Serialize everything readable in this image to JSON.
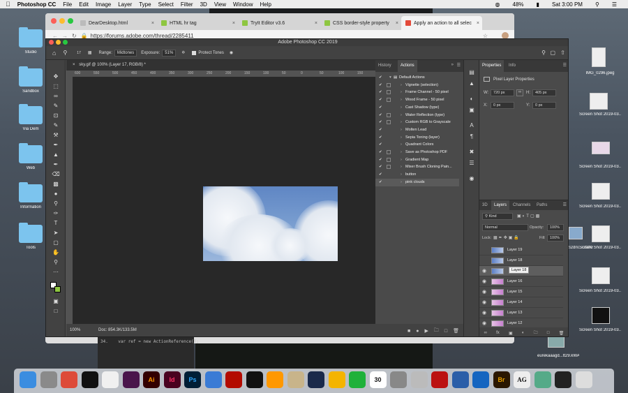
{
  "menubar": {
    "app_name": "Photoshop CC",
    "items": [
      "File",
      "Edit",
      "Image",
      "Layer",
      "Type",
      "Select",
      "Filter",
      "3D",
      "View",
      "Window",
      "Help"
    ],
    "battery": "48%",
    "clock": "Sat 3:00 PM"
  },
  "browser": {
    "tabs": [
      {
        "label": "DearDesktop.html",
        "color": "#bbbbbb"
      },
      {
        "label": "HTML hr tag",
        "color": "#8ec641"
      },
      {
        "label": "TryIt Editor v3.6",
        "color": "#8ec641"
      },
      {
        "label": "CSS border-style property",
        "color": "#8ec641"
      },
      {
        "label": "Apply an action to all selec",
        "color": "#e34a3a"
      }
    ],
    "url": "https://forums.adobe.com/thread/2285411"
  },
  "photoshop": {
    "window_title": "Adobe Photoshop CC 2019",
    "options": {
      "brush_size": "17",
      "range_label": "Range:",
      "range_value": "Midtones",
      "exposure_label": "Exposure:",
      "exposure_value": "51%",
      "protect_tones": "Protect Tones"
    },
    "document_tab": "sky.gif @ 100% (Layer 17, RGB/8) *",
    "ruler_ticks": [
      "600",
      "550",
      "500",
      "450",
      "400",
      "350",
      "300",
      "250",
      "200",
      "150",
      "100",
      "50",
      "0",
      "50",
      "100",
      "150",
      "200",
      "250",
      "300",
      "350",
      "400",
      "450",
      "500",
      "550",
      "600",
      "650",
      "700",
      "750",
      "800",
      "850",
      "900"
    ],
    "status": {
      "zoom": "100%",
      "doc_size": "Doc: 854.3K/133.5M"
    },
    "actions_panel": {
      "tabs": [
        "History",
        "Actions"
      ],
      "items": [
        {
          "label": "Default Actions",
          "folder": true
        },
        {
          "label": "Vignette (selection)"
        },
        {
          "label": "Frame Channel - 50 pixel"
        },
        {
          "label": "Wood Frame - 50 pixel"
        },
        {
          "label": "Cast Shadow (type)"
        },
        {
          "label": "Water Reflection (type)"
        },
        {
          "label": "Custom RGB to Grayscale"
        },
        {
          "label": "Molten Lead"
        },
        {
          "label": "Sepia Toning (layer)"
        },
        {
          "label": "Quadrant Colors"
        },
        {
          "label": "Save as Photoshop PDF"
        },
        {
          "label": "Gradient Map"
        },
        {
          "label": "Mixer Brush Cloning Pain..."
        },
        {
          "label": "button"
        },
        {
          "label": "pink clouds"
        }
      ]
    },
    "properties_panel": {
      "tabs": [
        "Properties",
        "Info"
      ],
      "subtitle": "Pixel Layer Properties",
      "w_label": "W:",
      "w_value": "720 px",
      "h_label": "H:",
      "h_value": "405 px",
      "x_label": "X:",
      "x_value": "0 px",
      "y_label": "Y:",
      "y_value": "0 px"
    },
    "layers_panel": {
      "tabs": [
        "3D",
        "Layers",
        "Channels",
        "Paths"
      ],
      "filter": "Kind",
      "blend_mode": "Normal",
      "opacity_label": "Opacity:",
      "opacity": "100%",
      "lock_label": "Lock:",
      "fill_label": "Fill:",
      "fill": "100%",
      "tooltip": "Layer 18",
      "layers": [
        {
          "name": "Layer 19",
          "visible": false,
          "kind": "blue"
        },
        {
          "name": "Layer 18",
          "visible": false,
          "kind": "blue"
        },
        {
          "name": "",
          "visible": true,
          "kind": "blue",
          "selected": true
        },
        {
          "name": "Layer 16",
          "visible": true,
          "kind": "pink"
        },
        {
          "name": "Layer 15",
          "visible": true,
          "kind": "pink"
        },
        {
          "name": "Layer 14",
          "visible": true,
          "kind": "pink"
        },
        {
          "name": "Layer 13",
          "visible": true,
          "kind": "pink"
        },
        {
          "name": "Layer 12",
          "visible": true,
          "kind": "pink"
        }
      ]
    }
  },
  "code": {
    "line_number": "34.",
    "line_text": "var ref = new ActionReference();"
  },
  "desktop": {
    "left_folders": [
      "Studio",
      "Sandbox",
      "Via Dem",
      "Web",
      "Information",
      "Tools"
    ],
    "right_files": [
      "IMG_0296.jpeg",
      "Screen Shot 2019-03...9.24 PM",
      "Screen Shot 2019-03...2.22 PM",
      "Screen Shot 2019-03...7.23 AM",
      "Screen Shot 2019-03...2.50 PM",
      "Screen Shot 2019-03...8.46 AM",
      "Screen Shot 2019-03...9.49 AM",
      "Screen Shot 2019-03...9.45 PM"
    ],
    "mid_file": "ezi2dnl...cd2fVs...500.png",
    "mid_file2": "eurekaaagd...tt29.kWA...Whale...500.png"
  },
  "dock": {
    "calendar_day": "30",
    "text_label": "AG",
    "icons": [
      "finder-icon",
      "launchpad-icon",
      "chrome-icon",
      "tidal-icon",
      "notes-icon",
      "slack-icon",
      "illustrator-icon",
      "indesign-icon",
      "photoshop-icon",
      "keynote-icon",
      "acrobat-icon",
      "github-icon",
      "sublime-icon",
      "fontbook-icon",
      "cinema4d-icon",
      "photos-icon",
      "messages-icon",
      "calendar-icon",
      "preferences-icon",
      "script-editor-icon",
      "filezilla-icon",
      "quicktime-icon",
      "vpn-icon",
      "bridge-icon",
      "font-icon",
      "preview-icon",
      "terminal-icon",
      "trash-icon"
    ],
    "labels": {
      "ai": "Ai",
      "id": "Id",
      "ps": "Ps",
      "br": "Br"
    }
  }
}
